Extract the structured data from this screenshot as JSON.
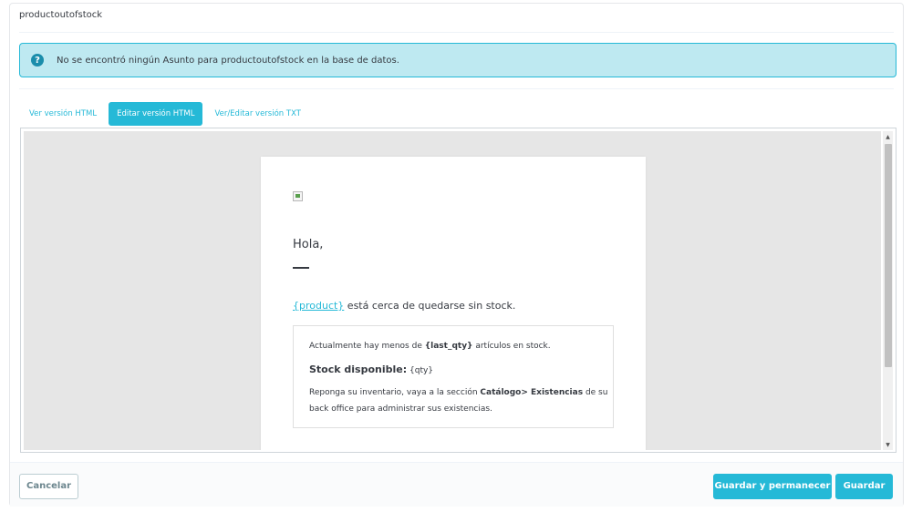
{
  "panel": {
    "title": "productoutofstock"
  },
  "alert": {
    "icon": "question-icon",
    "icon_glyph": "?",
    "message": "No se encontró ningún Asunto para productoutofstock en la base de datos."
  },
  "tabs": [
    {
      "label": "Ver versión HTML",
      "active": false
    },
    {
      "label": "Editar versión HTML",
      "active": true
    },
    {
      "label": "Ver/Editar versión TXT",
      "active": false
    }
  ],
  "email": {
    "greeting": "Hola,",
    "product_link": "{product}",
    "product_text": " está cerca de quedarse sin stock.",
    "line1_prefix": "Actualmente hay menos de ",
    "line1_var": "{last_qty}",
    "line1_suffix": " artículos en stock.",
    "stock_label": "Stock disponible:",
    "stock_value": " {qty}",
    "line3_prefix": "Reponga su inventario, vaya a la sección ",
    "line3_bold": "Catálogo> Existencias",
    "line3_suffix": " de su back office para administrar sus existencias."
  },
  "scrollbar": {
    "up_glyph": "▲",
    "down_glyph": "▼"
  },
  "footer": {
    "cancel_label": "Cancelar",
    "save_stay_label": "Guardar y permanecer",
    "save_label": "Guardar"
  },
  "colors": {
    "accent": "#25b9d7",
    "alert_bg": "#bee9f1"
  }
}
